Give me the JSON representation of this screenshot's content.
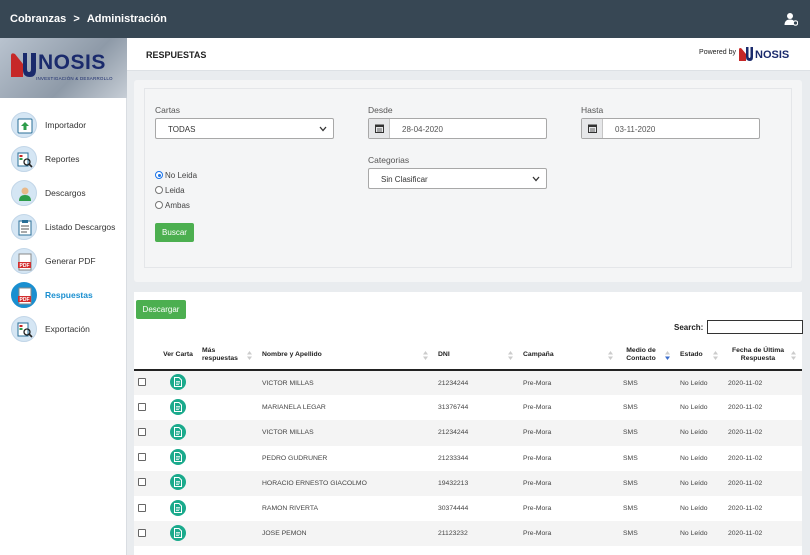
{
  "topbar": {
    "breadcrumb_root": "Cobranzas",
    "breadcrumb_sep": ">",
    "breadcrumb_current": "Administración",
    "user_icon": "user-cog-icon"
  },
  "sidebar": {
    "logo": {
      "word": "NOSIS",
      "tagline": "INVESTIGACIÓN & DESARROLLO"
    },
    "items": [
      {
        "label": "Importador",
        "icon": "upload-icon",
        "active": false
      },
      {
        "label": "Reportes",
        "icon": "report-search-icon",
        "active": false
      },
      {
        "label": "Descargos",
        "icon": "person-icon",
        "active": false
      },
      {
        "label": "Listado Descargos",
        "icon": "clipboard-list-icon",
        "active": false
      },
      {
        "label": "Generar PDF",
        "icon": "pdf-icon",
        "active": false
      },
      {
        "label": "Respuestas",
        "icon": "pdf-icon",
        "active": true
      },
      {
        "label": "Exportación",
        "icon": "report-search-icon",
        "active": false
      }
    ]
  },
  "header": {
    "title": "RESPUESTAS",
    "powered_by": "Powered by",
    "powered_logo": "NOSIS"
  },
  "filters": {
    "cartas_label": "Cartas",
    "cartas_value": "TODAS",
    "desde_label": "Desde",
    "desde_value": "28-04-2020",
    "hasta_label": "Hasta",
    "hasta_value": "03-11-2020",
    "categorias_label": "Categorias",
    "categorias_value": "Sin Clasificar",
    "radios": [
      {
        "label": "No Leida",
        "checked": true
      },
      {
        "label": "Leida",
        "checked": false
      },
      {
        "label": "Ambas",
        "checked": false
      }
    ],
    "buscar_label": "Buscar"
  },
  "content": {
    "descargar_label": "Descargar",
    "search_label": "Search:",
    "search_value": "",
    "columns": [
      "",
      "Ver Carta",
      "Más respuestas",
      "Nombre y Apellido",
      "DNI",
      "Campaña",
      "Medio de Contacto",
      "Estado",
      "Fecha de Última Respuesta"
    ],
    "rows": [
      {
        "nombre": "VICTOR MILLAS",
        "dni": "21234244",
        "campana": "Pre-Mora",
        "medio": "SMS",
        "estado": "No Leído",
        "fecha": "2020-11-02"
      },
      {
        "nombre": "MARIANELA LEGAR",
        "dni": "31376744",
        "campana": "Pre-Mora",
        "medio": "SMS",
        "estado": "No Leído",
        "fecha": "2020-11-02"
      },
      {
        "nombre": "VICTOR MILLAS",
        "dni": "21234244",
        "campana": "Pre-Mora",
        "medio": "SMS",
        "estado": "No Leído",
        "fecha": "2020-11-02"
      },
      {
        "nombre": "PEDRO GUDRUNER",
        "dni": "21233344",
        "campana": "Pre-Mora",
        "medio": "SMS",
        "estado": "No Leído",
        "fecha": "2020-11-02"
      },
      {
        "nombre": "HORACIO ERNESTO GIACOLMO",
        "dni": "19432213",
        "campana": "Pre-Mora",
        "medio": "SMS",
        "estado": "No Leído",
        "fecha": "2020-11-02"
      },
      {
        "nombre": "RAMON RIVERTA",
        "dni": "30374444",
        "campana": "Pre-Mora",
        "medio": "SMS",
        "estado": "No Leído",
        "fecha": "2020-11-02"
      },
      {
        "nombre": "JOSE PEMON",
        "dni": "21123232",
        "campana": "Pre-Mora",
        "medio": "SMS",
        "estado": "No Leído",
        "fecha": "2020-11-02"
      }
    ]
  },
  "colors": {
    "topbar": "#374754",
    "accent": "#1a8fd0",
    "green": "#4caf50",
    "doc_button": "#1aaa8c",
    "brand": "#1a2a6c"
  }
}
